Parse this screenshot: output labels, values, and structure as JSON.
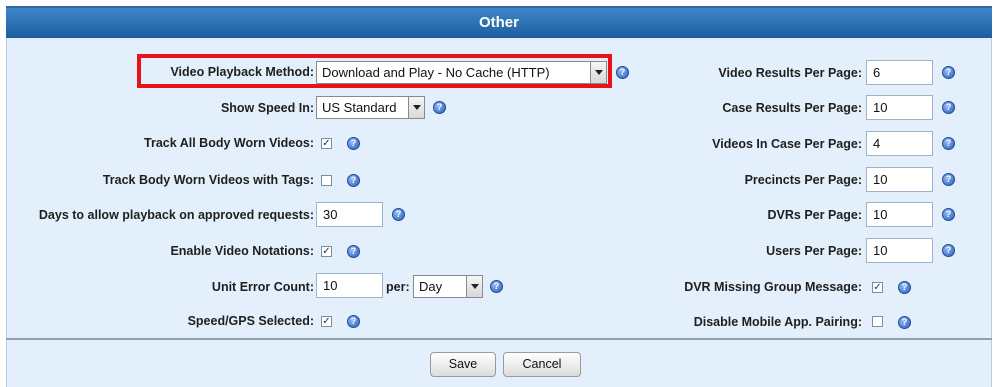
{
  "header": {
    "title": "Other"
  },
  "left": {
    "video_playback": {
      "label": "Video Playback Method:",
      "value": "Download and Play - No Cache (HTTP)"
    },
    "show_speed": {
      "label": "Show Speed In:",
      "value": "US Standard"
    },
    "track_all_bwv": {
      "label": "Track All Body Worn Videos:",
      "checked": true
    },
    "track_bwv_tags": {
      "label": "Track Body Worn Videos with Tags:",
      "checked": false
    },
    "days_playback": {
      "label": "Days to allow playback on approved requests:",
      "value": "30"
    },
    "video_notations": {
      "label": "Enable Video Notations:",
      "checked": true
    },
    "unit_error": {
      "label": "Unit Error Count:",
      "value": "10",
      "per_label": "per:",
      "per_value": "Day"
    },
    "speed_gps": {
      "label": "Speed/GPS Selected:",
      "checked": true
    }
  },
  "right": {
    "video_results": {
      "label": "Video Results Per Page:",
      "value": "6"
    },
    "case_results": {
      "label": "Case Results Per Page:",
      "value": "10"
    },
    "videos_in_case": {
      "label": "Videos In Case Per Page:",
      "value": "4"
    },
    "precincts": {
      "label": "Precincts Per Page:",
      "value": "10"
    },
    "dvrs": {
      "label": "DVRs Per Page:",
      "value": "10"
    },
    "users": {
      "label": "Users Per Page:",
      "value": "10"
    },
    "dvr_missing": {
      "label": "DVR Missing Group Message:",
      "checked": true
    },
    "disable_mobile": {
      "label": "Disable Mobile App. Pairing:",
      "checked": false
    }
  },
  "buttons": {
    "save": "Save",
    "cancel": "Cancel"
  },
  "help_glyph": "?",
  "check_glyph": "✓",
  "colors": {
    "header": "#1c5e9e",
    "panel": "#e3effb",
    "highlight": "#e8121b"
  }
}
